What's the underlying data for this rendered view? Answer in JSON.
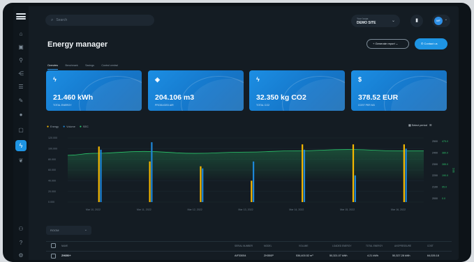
{
  "search": {
    "placeholder": "Search"
  },
  "site_selector": {
    "label": "Your loops",
    "value": "DEMO SITE"
  },
  "user": {
    "initials": "MF"
  },
  "page": {
    "title": "Energy manager"
  },
  "tabs": [
    {
      "label": "Overview"
    },
    {
      "label": "Benchmark"
    },
    {
      "label": "Savings"
    },
    {
      "label": "Control central"
    }
  ],
  "actions": {
    "generate_report": "Generate report",
    "contact_us": "Contact us"
  },
  "kpis": [
    {
      "icon": "lightning-icon",
      "value": "21.460 kWh",
      "label": "TOTAL ENERGY"
    },
    {
      "icon": "air-compressor-icon",
      "value": "204.106 m3",
      "label": "PRODUCED AIR"
    },
    {
      "icon": "lightning-icon",
      "value": "32.350 kg CO2",
      "label": "TOTAL CO2"
    },
    {
      "icon": "dollar-icon",
      "value": "378.52 EUR",
      "label": "COST PER M3"
    }
  ],
  "chart_legend": [
    {
      "name": "Energy",
      "color": "#f5b800"
    },
    {
      "name": "Volume",
      "color": "#1e86d8"
    },
    {
      "name": "SEC",
      "color": "#2bc46b"
    }
  ],
  "select_period": "Select period",
  "chart_data": {
    "type": "bar",
    "categories": [
      "Mar 10, 2022",
      "Mar 11, 2022",
      "Mar 12, 2022",
      "Mar 13, 2022",
      "Mar 14, 2022",
      "Mar 15, 2022",
      "Mar 16, 2022"
    ],
    "series": [
      {
        "name": "Energy",
        "values": [
          104000,
          76000,
          67000,
          40000,
          108000,
          108000,
          108000
        ]
      },
      {
        "name": "Volume",
        "values": [
          98000,
          112000,
          63000,
          76000,
          98000,
          50000,
          100000
        ]
      },
      {
        "name": "SEC",
        "values": [
          2760,
          2790,
          2760,
          2780,
          2800,
          2820,
          2800
        ]
      }
    ],
    "y_left": {
      "ticks": [
        "0.000",
        "20.000",
        "40.000",
        "60.000",
        "80.000",
        "100.000",
        "120.000"
      ],
      "range": [
        0,
        120000
      ]
    },
    "y_right": {
      "ticks": [
        "2000",
        "2100",
        "2200",
        "2300",
        "2400",
        "2500"
      ],
      "ticks_secondary": [
        "0.0",
        "95.0",
        "190.0",
        "285.0",
        "380.0",
        "475.0"
      ],
      "range": [
        2000,
        3000
      ]
    },
    "ylabel_right": "SEC"
  },
  "filter": {
    "value": "ROOM"
  },
  "table": {
    "headers": [
      "NAME",
      "SERIAL NUMBER",
      "MODEL",
      "VOLUME",
      "LOADED ENERGY",
      "TOTAL ENERGY",
      "AVGPRESSURE",
      "COST"
    ],
    "rows": [
      [
        "ZH350+",
        "AIF33054",
        "ZH350P",
        "536,400.52 m³",
        "50,321.07 kWh",
        "4.21 kWh",
        "50,327.28 kWh",
        "64,026.18"
      ]
    ]
  }
}
